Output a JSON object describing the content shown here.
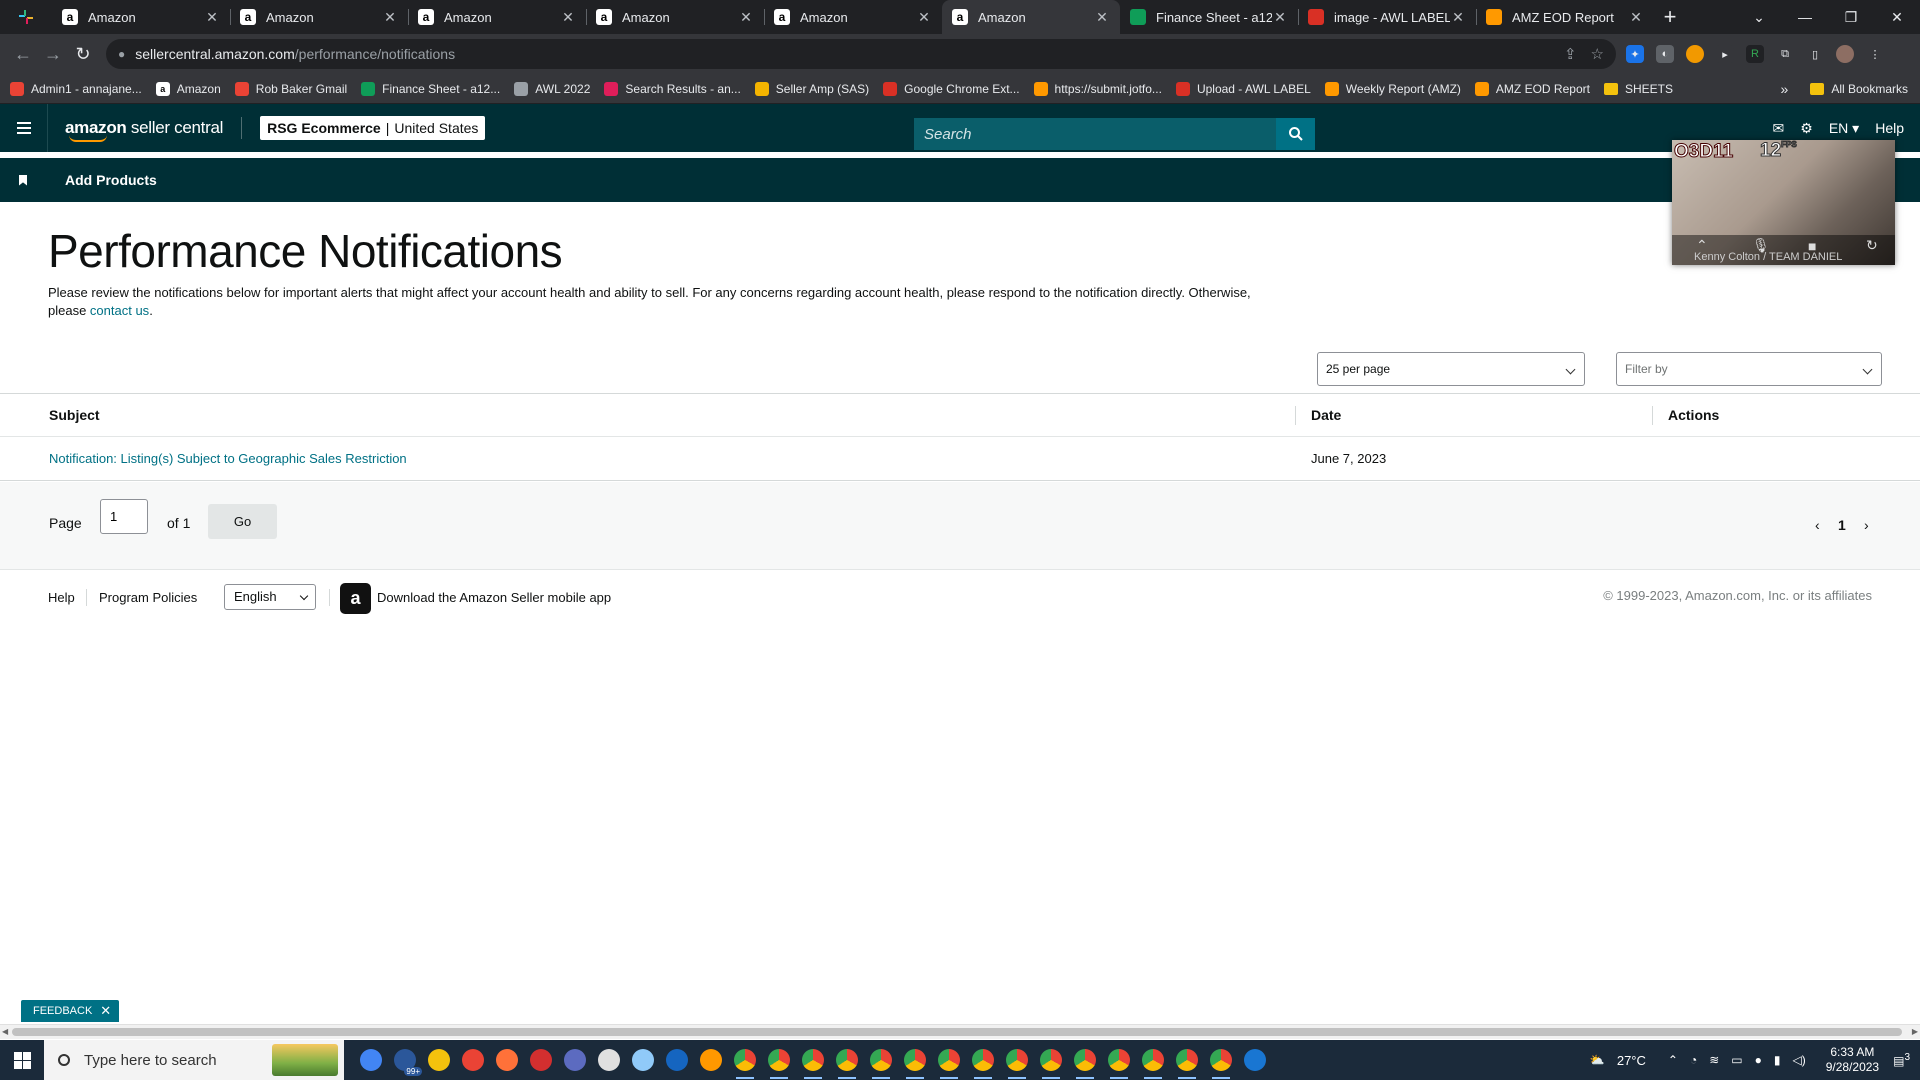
{
  "browser": {
    "tabs": [
      {
        "label": "Amazon",
        "icon": "amazon-icon",
        "color": "#ffffff"
      },
      {
        "label": "Amazon",
        "icon": "amazon-icon",
        "color": "#ffffff"
      },
      {
        "label": "Amazon",
        "icon": "amazon-icon",
        "color": "#ffffff"
      },
      {
        "label": "Amazon",
        "icon": "amazon-icon",
        "color": "#ffffff"
      },
      {
        "label": "Amazon",
        "icon": "amazon-icon",
        "color": "#ffffff"
      },
      {
        "label": "Amazon",
        "icon": "amazon-icon",
        "color": "#ffffff",
        "active": true
      },
      {
        "label": "Finance Sheet - a12",
        "icon": "sheets-icon",
        "color": "#0f9d58"
      },
      {
        "label": "image - AWL LABEL",
        "icon": "awl-icon",
        "color": "#d93025"
      },
      {
        "label": "AMZ EOD Report",
        "icon": "clickup-icon",
        "color": "#ff9900"
      }
    ],
    "url_host": "sellercentral.amazon.com",
    "url_path": "/performance/notifications",
    "bookmarks": [
      {
        "label": "Admin1 - annajane...",
        "icon": "gmail-icon",
        "color": "#ea4335"
      },
      {
        "label": "Amazon",
        "icon": "amazon-icon",
        "color": "#ffffff"
      },
      {
        "label": "Rob Baker Gmail",
        "icon": "gmail-icon",
        "color": "#ea4335"
      },
      {
        "label": "Finance Sheet - a12...",
        "icon": "sheets-icon",
        "color": "#0f9d58"
      },
      {
        "label": "AWL 2022",
        "icon": "globe-icon",
        "color": "#9aa0a6"
      },
      {
        "label": "Search Results - an...",
        "icon": "slack-icon",
        "color": "#e01e5a"
      },
      {
        "label": "Seller Amp (SAS)",
        "icon": "selleramp-icon",
        "color": "#f4b400"
      },
      {
        "label": "Google Chrome Ext...",
        "icon": "check-icon",
        "color": "#d93025"
      },
      {
        "label": "https://submit.jotfo...",
        "icon": "jotform-icon",
        "color": "#ff9900"
      },
      {
        "label": "Upload - AWL LABEL",
        "icon": "awl-icon",
        "color": "#d93025"
      },
      {
        "label": "Weekly Report (AMZ)",
        "icon": "clickup-icon",
        "color": "#ff9900"
      },
      {
        "label": "AMZ EOD Report",
        "icon": "clickup-icon",
        "color": "#ff9900"
      },
      {
        "label": "SHEETS",
        "icon": "folder-icon",
        "color": "#f4c20d"
      }
    ],
    "all_bookmarks": "All Bookmarks"
  },
  "header": {
    "logo_bold": "amazon",
    "logo_light": " seller central",
    "account_name": "RSG Ecommerce",
    "account_divider": "|",
    "marketplace": "United States",
    "search_placeholder": "Search",
    "language": "EN",
    "help": "Help"
  },
  "subnav": {
    "add_products": "Add Products"
  },
  "video": {
    "code": "O3D11",
    "fps": "12",
    "fps_unit": "FPS",
    "name": "Kenny Colton / TEAM DANIEL"
  },
  "page": {
    "title": "Performance Notifications",
    "intro": "Please review the notifications below for important alerts that might affect your account health and ability to sell. For any concerns regarding account health, please respond to the notification directly. Otherwise, please ",
    "contact_link": "contact us",
    "intro_end": ".",
    "per_page": "25 per page",
    "filter_placeholder": "Filter by"
  },
  "table": {
    "headers": {
      "subject": "Subject",
      "date": "Date",
      "actions": "Actions"
    },
    "rows": [
      {
        "subject": "Notification: Listing(s) Subject to Geographic Sales Restriction",
        "date": "June 7, 2023",
        "actions": ""
      }
    ]
  },
  "pagination": {
    "page_label": "Page",
    "current": "1",
    "of_label": "of 1",
    "go": "Go",
    "page_number": "1"
  },
  "footer": {
    "help": "Help",
    "policies": "Program Policies",
    "language": "English",
    "app_text": "Download the Amazon Seller mobile app",
    "copyright": "© 1999-2023, Amazon.com, Inc. or its affiliates"
  },
  "feedback": "FEEDBACK",
  "taskbar": {
    "search_placeholder": "Type here to search",
    "mail_badge": "99+",
    "temperature": "27°C",
    "time": "6:33 AM",
    "date": "9/28/2023",
    "notification_count": "3"
  }
}
